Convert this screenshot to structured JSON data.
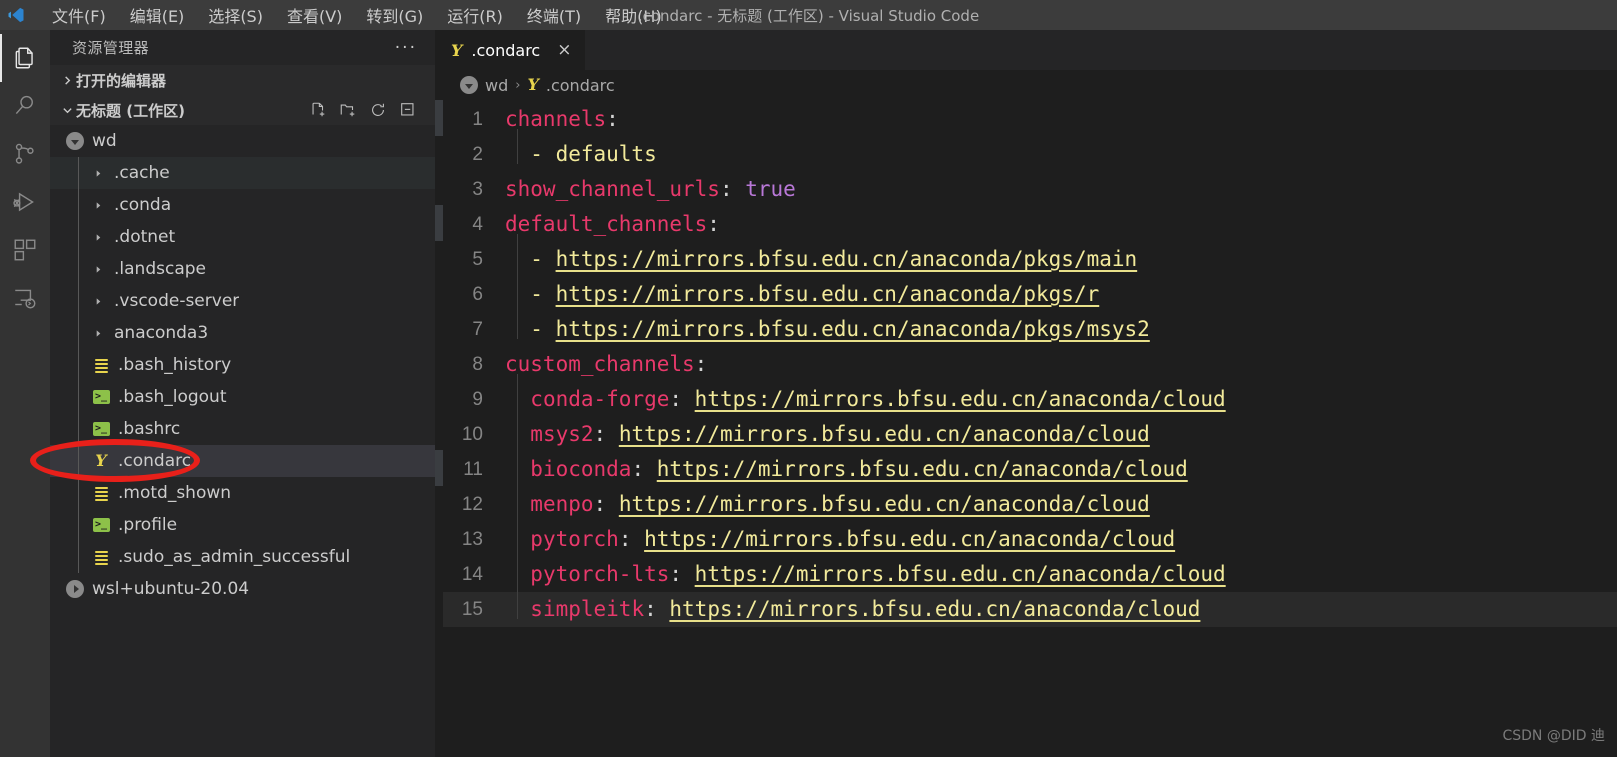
{
  "titlebar": {
    "window_title": ".condarc - 无标题 (工作区) - Visual Studio Code",
    "menu": [
      {
        "label": "文件(F)"
      },
      {
        "label": "编辑(E)"
      },
      {
        "label": "选择(S)"
      },
      {
        "label": "查看(V)"
      },
      {
        "label": "转到(G)"
      },
      {
        "label": "运行(R)"
      },
      {
        "label": "终端(T)"
      },
      {
        "label": "帮助(H)"
      }
    ]
  },
  "activitybar": {
    "items": [
      {
        "icon": "files-explorer-icon",
        "active": true
      },
      {
        "icon": "search-icon",
        "active": false
      },
      {
        "icon": "source-control-icon",
        "active": false
      },
      {
        "icon": "run-and-debug-icon",
        "active": false
      },
      {
        "icon": "extensions-icon",
        "active": false
      },
      {
        "icon": "remote-explorer-icon",
        "active": false
      }
    ]
  },
  "sidebar": {
    "title": "资源管理器",
    "more_actions": "···",
    "open_editors": {
      "label": "打开的编辑器",
      "expanded": false
    },
    "workspace": {
      "label": "无标题 (工作区)",
      "expanded": true,
      "actions": [
        "new-file-icon",
        "new-folder-icon",
        "refresh-icon",
        "collapse-all-icon"
      ]
    },
    "tree": [
      {
        "label": "wd",
        "type": "root-folder",
        "icon": "wsl-circle-icon",
        "expanded": true,
        "depth": 0
      },
      {
        "label": ".cache",
        "type": "folder",
        "icon": "chevron-right-icon",
        "depth": 1,
        "state": "hover"
      },
      {
        "label": ".conda",
        "type": "folder",
        "icon": "chevron-right-icon",
        "depth": 1
      },
      {
        "label": ".dotnet",
        "type": "folder",
        "icon": "chevron-right-icon",
        "depth": 1
      },
      {
        "label": ".landscape",
        "type": "folder",
        "icon": "chevron-right-icon",
        "depth": 1
      },
      {
        "label": ".vscode-server",
        "type": "folder",
        "icon": "chevron-right-icon",
        "depth": 1
      },
      {
        "label": "anaconda3",
        "type": "folder",
        "icon": "chevron-right-icon",
        "depth": 1
      },
      {
        "label": ".bash_history",
        "type": "file",
        "icon": "text-file-icon",
        "depth": 1
      },
      {
        "label": ".bash_logout",
        "type": "file",
        "icon": "shell-script-icon",
        "depth": 1
      },
      {
        "label": ".bashrc",
        "type": "file",
        "icon": "shell-script-icon",
        "depth": 1
      },
      {
        "label": ".condarc",
        "type": "file",
        "icon": "yaml-file-icon",
        "depth": 1,
        "state": "selected"
      },
      {
        "label": ".motd_shown",
        "type": "file",
        "icon": "text-file-icon",
        "depth": 1
      },
      {
        "label": ".profile",
        "type": "file",
        "icon": "shell-script-icon",
        "depth": 1
      },
      {
        "label": ".sudo_as_admin_successful",
        "type": "file",
        "icon": "text-file-icon",
        "depth": 1
      },
      {
        "label": "wsl+ubuntu-20.04",
        "type": "root-folder",
        "icon": "wsl-circle-collapsed-icon",
        "expanded": false,
        "depth": 0
      }
    ]
  },
  "editor": {
    "tab": {
      "label": ".condarc",
      "icon": "yaml-file-icon",
      "close": "×"
    },
    "breadcrumb": [
      {
        "label": "wd",
        "icon": "wsl-circle-icon"
      },
      {
        "label": ".condarc",
        "icon": "yaml-file-icon"
      }
    ],
    "breadcrumb_separator": "›",
    "current_line": 15,
    "lines": [
      {
        "n": 1,
        "tokens": [
          {
            "t": "channels",
            "c": "key"
          },
          {
            "t": ":",
            "c": "colon"
          }
        ]
      },
      {
        "n": 2,
        "indent_guide": true,
        "tokens": [
          {
            "t": "  - ",
            "c": "punc"
          },
          {
            "t": "defaults",
            "c": "str"
          }
        ]
      },
      {
        "n": 3,
        "tokens": [
          {
            "t": "show_channel_urls",
            "c": "key"
          },
          {
            "t": ": ",
            "c": "colon"
          },
          {
            "t": "true",
            "c": "bool"
          }
        ]
      },
      {
        "n": 4,
        "tokens": [
          {
            "t": "default_channels",
            "c": "key"
          },
          {
            "t": ":",
            "c": "colon"
          }
        ]
      },
      {
        "n": 5,
        "indent_guide": true,
        "tokens": [
          {
            "t": "  - ",
            "c": "punc"
          },
          {
            "t": "https://mirrors.bfsu.edu.cn/anaconda/pkgs/main",
            "c": "link"
          }
        ]
      },
      {
        "n": 6,
        "indent_guide": true,
        "tokens": [
          {
            "t": "  - ",
            "c": "punc"
          },
          {
            "t": "https://mirrors.bfsu.edu.cn/anaconda/pkgs/r",
            "c": "link"
          }
        ]
      },
      {
        "n": 7,
        "indent_guide": true,
        "tokens": [
          {
            "t": "  - ",
            "c": "punc"
          },
          {
            "t": "https://mirrors.bfsu.edu.cn/anaconda/pkgs/msys2",
            "c": "link"
          }
        ]
      },
      {
        "n": 8,
        "tokens": [
          {
            "t": "custom_channels",
            "c": "key"
          },
          {
            "t": ":",
            "c": "colon"
          }
        ]
      },
      {
        "n": 9,
        "indent_guide": true,
        "tokens": [
          {
            "t": "  ",
            "c": "punc"
          },
          {
            "t": "conda-forge",
            "c": "key"
          },
          {
            "t": ": ",
            "c": "colon"
          },
          {
            "t": "https://mirrors.bfsu.edu.cn/anaconda/cloud",
            "c": "link"
          }
        ]
      },
      {
        "n": 10,
        "indent_guide": true,
        "tokens": [
          {
            "t": "  ",
            "c": "punc"
          },
          {
            "t": "msys2",
            "c": "key"
          },
          {
            "t": ": ",
            "c": "colon"
          },
          {
            "t": "https://mirrors.bfsu.edu.cn/anaconda/cloud",
            "c": "link"
          }
        ]
      },
      {
        "n": 11,
        "indent_guide": true,
        "tokens": [
          {
            "t": "  ",
            "c": "punc"
          },
          {
            "t": "bioconda",
            "c": "key"
          },
          {
            "t": ": ",
            "c": "colon"
          },
          {
            "t": "https://mirrors.bfsu.edu.cn/anaconda/cloud",
            "c": "link"
          }
        ]
      },
      {
        "n": 12,
        "indent_guide": true,
        "tokens": [
          {
            "t": "  ",
            "c": "punc"
          },
          {
            "t": "menpo",
            "c": "key"
          },
          {
            "t": ": ",
            "c": "colon"
          },
          {
            "t": "https://mirrors.bfsu.edu.cn/anaconda/cloud",
            "c": "link"
          }
        ]
      },
      {
        "n": 13,
        "indent_guide": true,
        "tokens": [
          {
            "t": "  ",
            "c": "punc"
          },
          {
            "t": "pytorch",
            "c": "key"
          },
          {
            "t": ": ",
            "c": "colon"
          },
          {
            "t": "https://mirrors.bfsu.edu.cn/anaconda/cloud",
            "c": "link"
          }
        ]
      },
      {
        "n": 14,
        "indent_guide": true,
        "tokens": [
          {
            "t": "  ",
            "c": "punc"
          },
          {
            "t": "pytorch-lts",
            "c": "key"
          },
          {
            "t": ": ",
            "c": "colon"
          },
          {
            "t": "https://mirrors.bfsu.edu.cn/anaconda/cloud",
            "c": "link"
          }
        ]
      },
      {
        "n": 15,
        "indent_guide": true,
        "current": true,
        "tokens": [
          {
            "t": "  ",
            "c": "punc"
          },
          {
            "t": "simpleitk",
            "c": "key"
          },
          {
            "t": ": ",
            "c": "colon"
          },
          {
            "t": "https://mirrors.bfsu.edu.cn/anaconda/cloud",
            "c": "link"
          }
        ]
      }
    ]
  },
  "annotation": {
    "shape": "ellipse",
    "color": "#e8201a",
    "target": ".condarc"
  },
  "watermark": "CSDN @DID 迪",
  "colors": {
    "titlebar_bg": "#3c3c3c",
    "activitybar_bg": "#333333",
    "sidebar_bg": "#252526",
    "editor_bg": "#1e1e1e",
    "selected_row_bg": "#37373d",
    "yaml_key": "#e8396b",
    "yaml_string": "#f2ea9b",
    "yaml_bool": "#b978d8",
    "line_number": "#858585",
    "annotation_red": "#e8201a"
  }
}
